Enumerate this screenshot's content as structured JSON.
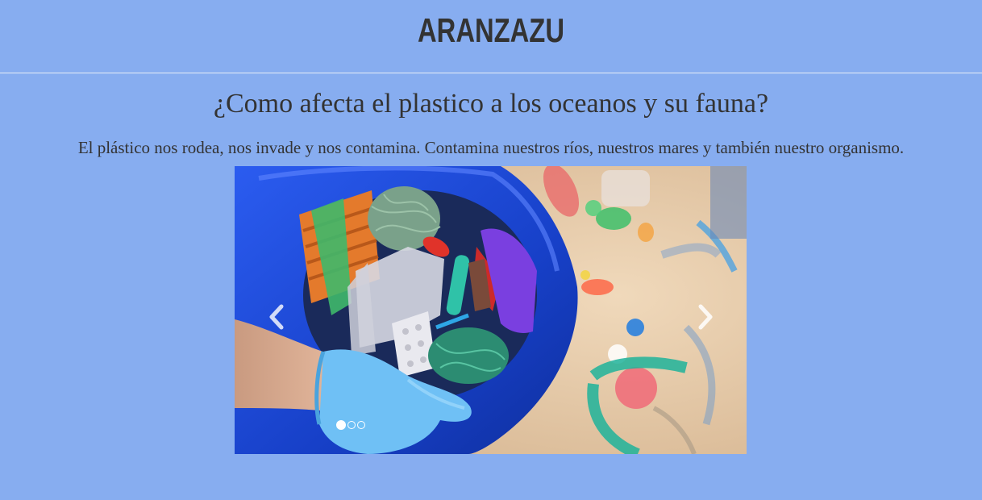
{
  "header": {
    "logo": "ARANZAZU"
  },
  "main": {
    "title": "¿Como afecta el plastico a los oceanos y su fauna?",
    "intro": "El plástico nos rodea, nos invade y nos contamina. Contamina nuestros ríos, nuestros mares y también nuestro organismo."
  },
  "carousel": {
    "slide_count": 3,
    "active_slide": 1,
    "prev_icon": "chevron-left-icon",
    "next_icon": "chevron-right-icon"
  },
  "colors": {
    "background": "#87adf0",
    "text": "#333333",
    "bag_blue": "#1f4fe0",
    "glove_blue": "#5fb6f0",
    "sand": "#e6ccaa"
  }
}
